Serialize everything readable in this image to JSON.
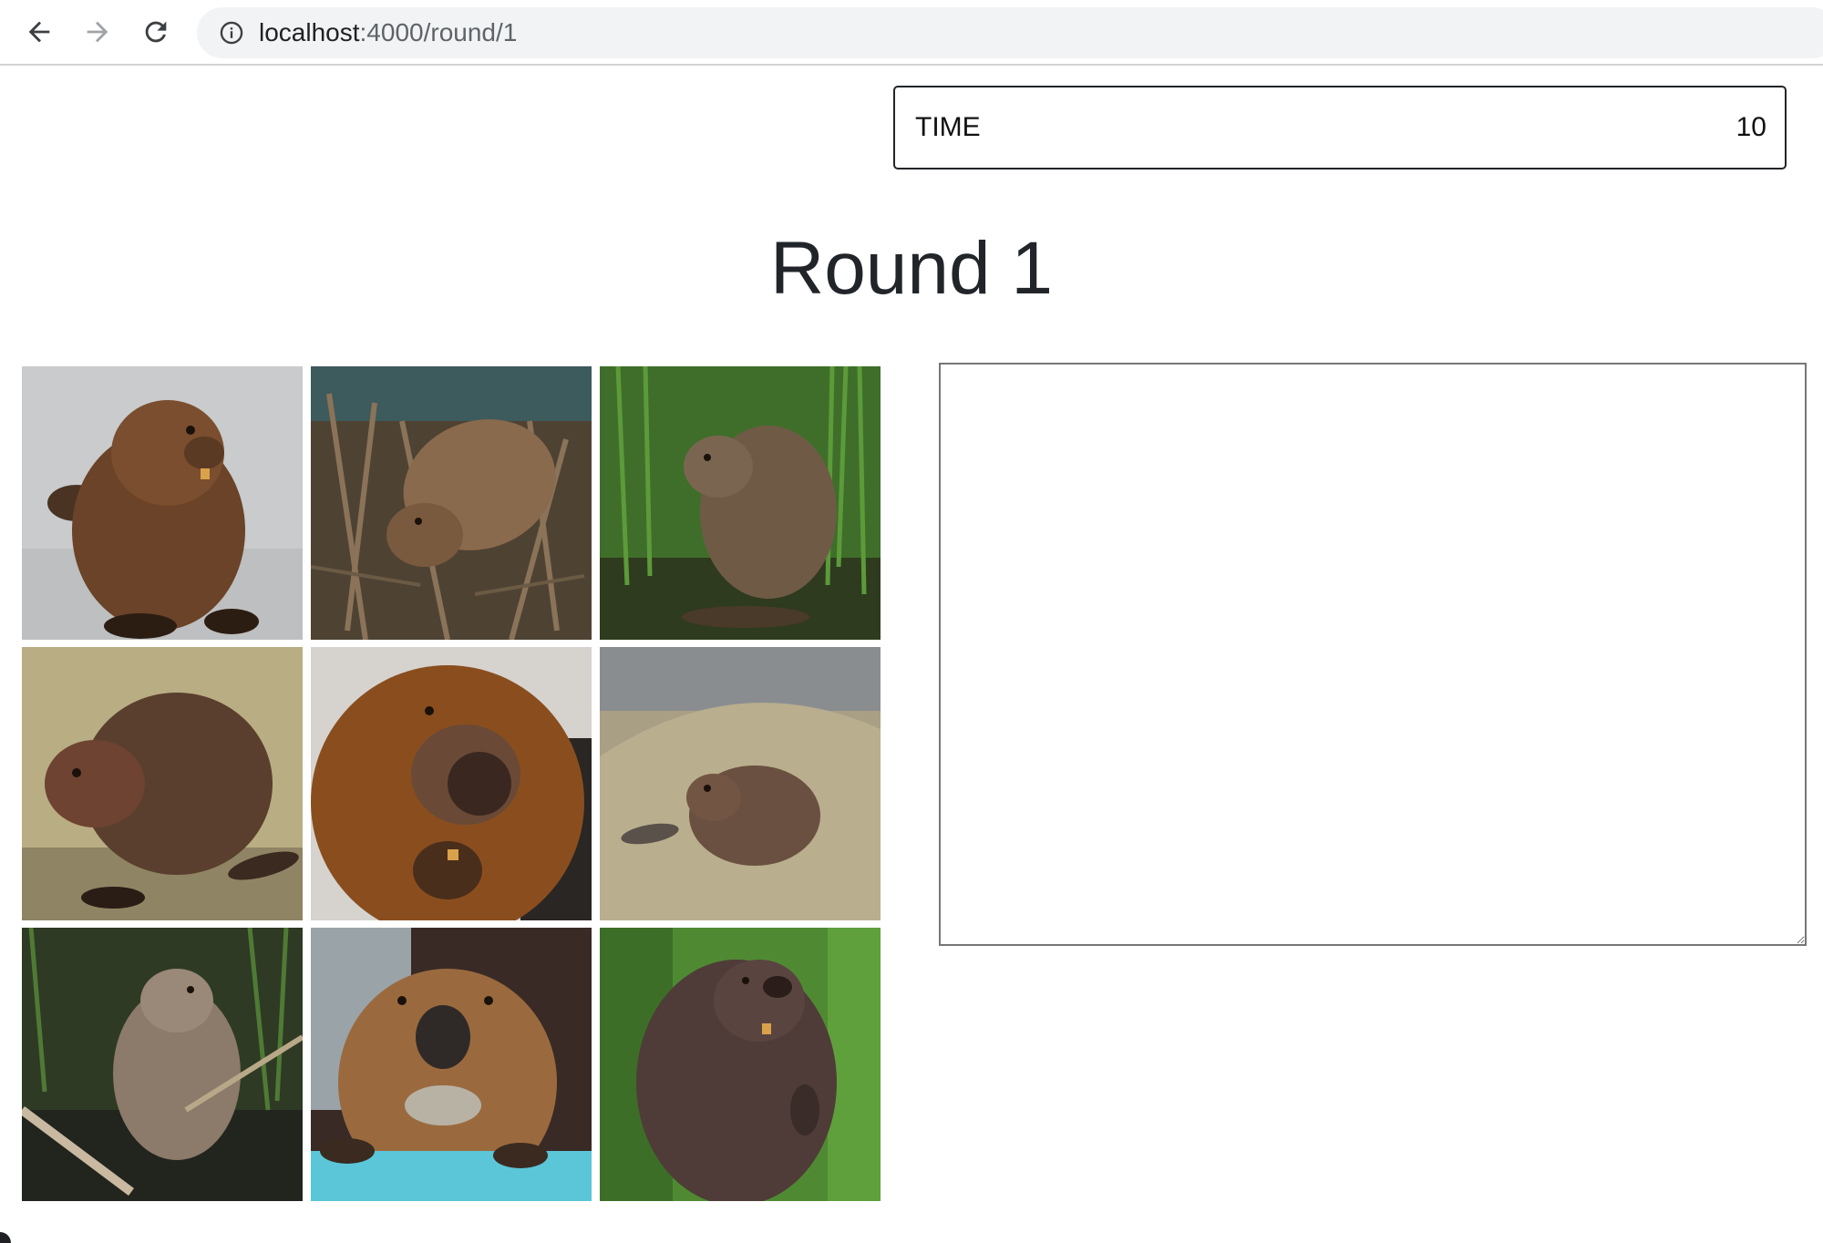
{
  "browser": {
    "url_host": "localhost",
    "url_path": ":4000/round/1"
  },
  "timer": {
    "label": "TIME",
    "value": "10"
  },
  "round": {
    "title": "Round 1"
  },
  "images": [
    {
      "name": "beaver-image-1"
    },
    {
      "name": "beaver-image-2"
    },
    {
      "name": "beaver-image-3"
    },
    {
      "name": "beaver-image-4"
    },
    {
      "name": "beaver-image-5"
    },
    {
      "name": "beaver-image-6"
    },
    {
      "name": "beaver-image-7"
    },
    {
      "name": "beaver-image-8"
    },
    {
      "name": "beaver-image-9"
    }
  ],
  "answer": {
    "value": "",
    "placeholder": ""
  }
}
